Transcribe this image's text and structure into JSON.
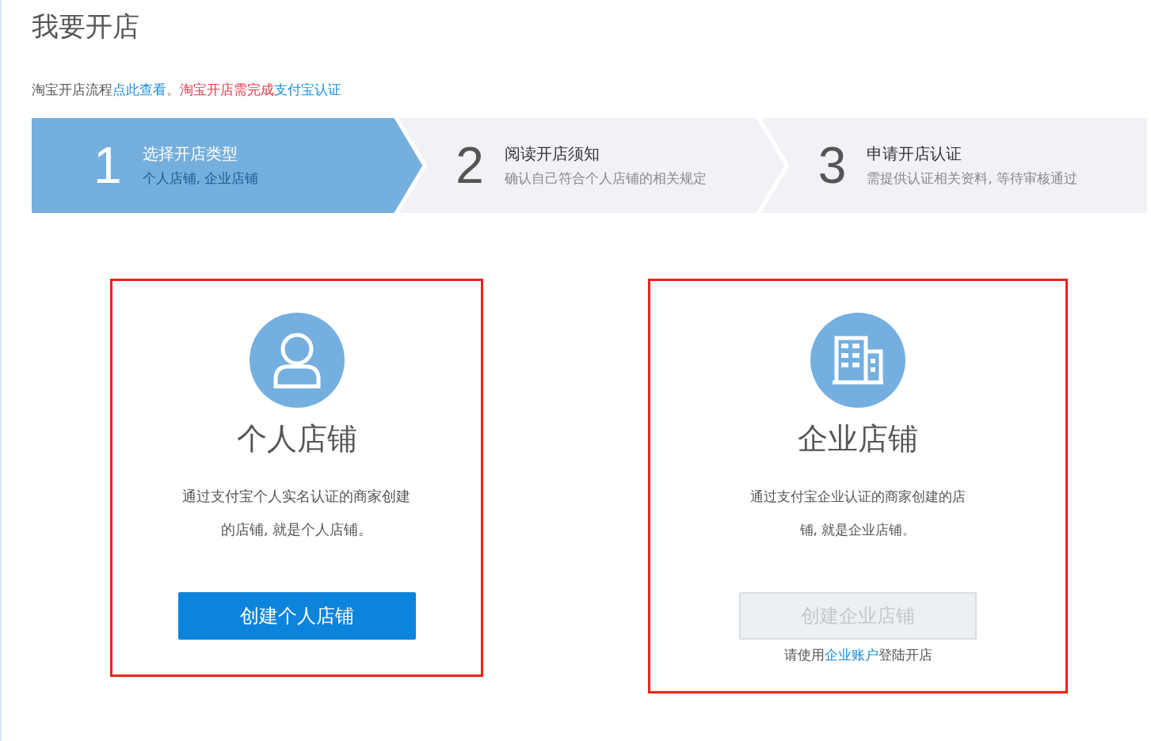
{
  "title": "我要开店",
  "notice": [
    {
      "kind": "plain",
      "text": "淘宝开店流程"
    },
    {
      "kind": "link",
      "text": "点此查看"
    },
    {
      "kind": "plain",
      "text": "。"
    },
    {
      "kind": "alert",
      "text": "淘宝开店需完成"
    },
    {
      "kind": "link",
      "text": "支付宝认证"
    }
  ],
  "steps": [
    {
      "number": "1",
      "title": "选择开店类型",
      "subtitle": "个人店铺, 企业店铺",
      "selected": true
    },
    {
      "number": "2",
      "title": "阅读开店须知",
      "subtitle": "确认自己符合个人店铺的相关规定",
      "selected": false
    },
    {
      "number": "3",
      "title": "申请开店认证",
      "subtitle": "需提供认证相关资料, 等待审核通过",
      "selected": false
    }
  ],
  "cards": [
    {
      "kind": "personal",
      "title": "个人店铺",
      "description": "通过支付宝个人实名认证的商家创建的店铺, 就是个人店铺。",
      "button": {
        "label": "创建个人店铺",
        "disabled": false
      }
    },
    {
      "kind": "enterprise",
      "title": "企业店铺",
      "description": "通过支付宝企业认证的商家创建的店铺, 就是企业店铺。",
      "button": {
        "label": "创建企业店铺",
        "disabled": true
      },
      "note": [
        {
          "kind": "plain",
          "text": "请使用"
        },
        {
          "kind": "link",
          "text": "企业账户"
        },
        {
          "kind": "plain",
          "text": "登陆开店"
        }
      ]
    }
  ]
}
